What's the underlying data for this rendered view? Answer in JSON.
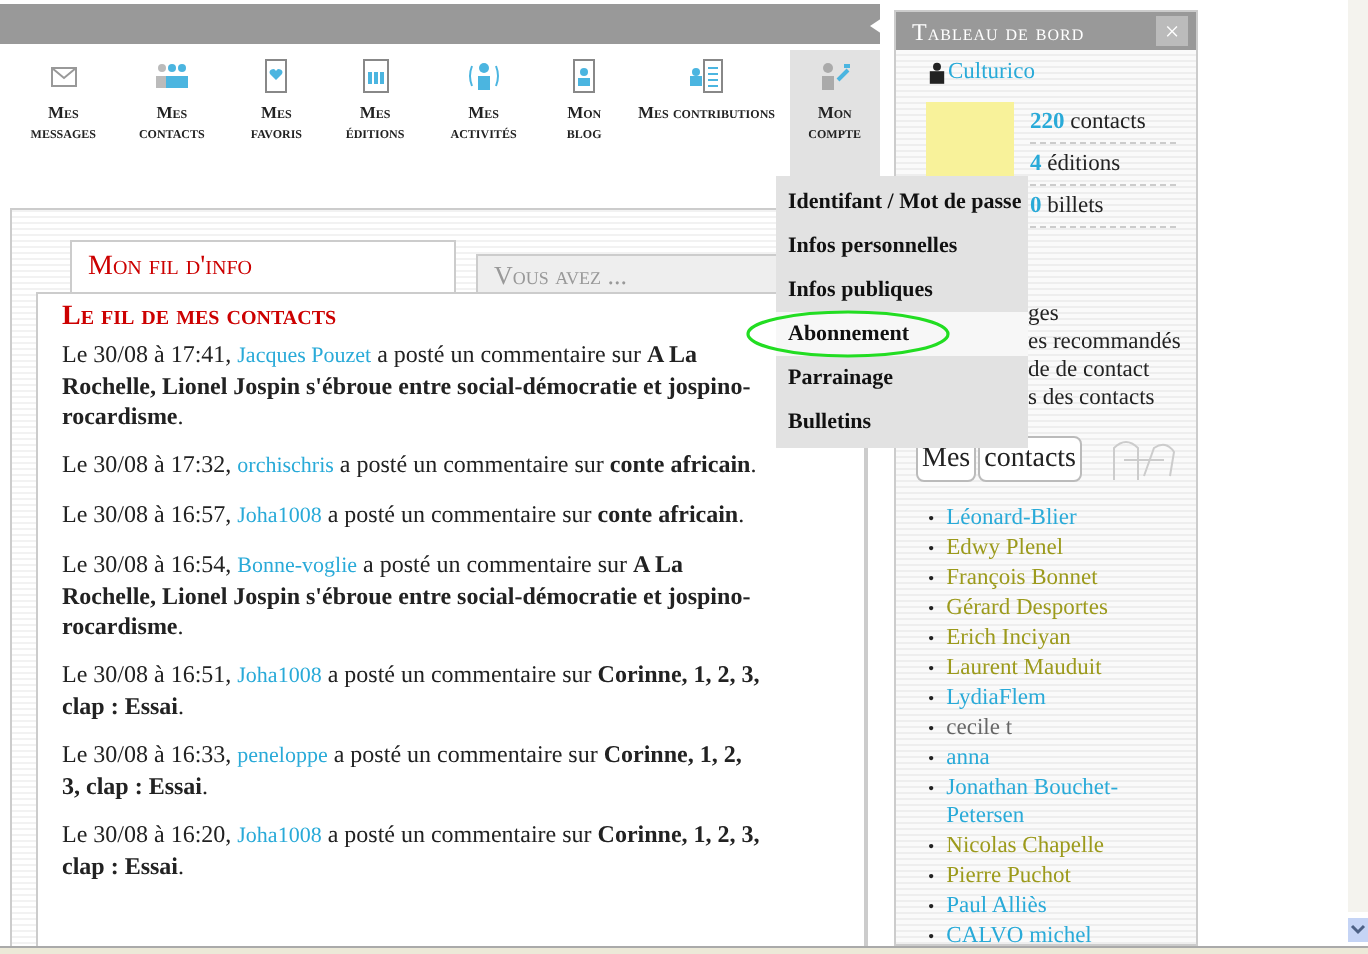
{
  "nav": [
    {
      "label": "Mes messages",
      "selected": false
    },
    {
      "label": "Mes contacts",
      "selected": false
    },
    {
      "label": "Mes favoris",
      "selected": false
    },
    {
      "label": "Mes éditions",
      "selected": false
    },
    {
      "label": "Mes activités",
      "selected": false
    },
    {
      "label": "Mon blog",
      "selected": false
    },
    {
      "label": "Mes contributions",
      "selected": false
    },
    {
      "label": "Mon compte",
      "selected": true
    }
  ],
  "account_menu": [
    {
      "label": "Identifant / Mot de passe",
      "selected": false,
      "circled": false
    },
    {
      "label": "Infos personnelles",
      "selected": false,
      "circled": false
    },
    {
      "label": "Infos publiques",
      "selected": false,
      "circled": false
    },
    {
      "label": "Abonnement",
      "selected": true,
      "circled": true
    },
    {
      "label": "Parrainage",
      "selected": false,
      "circled": false
    },
    {
      "label": "Bulletins",
      "selected": false,
      "circled": false
    }
  ],
  "tabs": [
    {
      "label": "Mon fil d'info",
      "selected": true
    },
    {
      "label": "Vous avez ...",
      "selected": false
    }
  ],
  "feed": {
    "heading": "Le fil de mes contacts",
    "entries": [
      {
        "when": "Le 30/08 à 17:41,",
        "user": "Jacques Pouzet",
        "text": "a posté un commentaire sur **A La Rochelle, Lionel Jospin s'ébroue entre social-démocratie et jospino-rocardisme**."
      },
      {
        "when": "Le 30/08 à 17:32,",
        "user": "orchischris",
        "text": "a posté un commentaire sur **conte africain**."
      },
      {
        "when": "Le 30/08 à 16:57,",
        "user": "Joha1008",
        "text": "a posté un commentaire sur **conte africain**."
      },
      {
        "when": "Le 30/08 à 16:54,",
        "user": "Bonne-voglie",
        "text": "a posté un commentaire sur **A La Rochelle, Lionel Jospin s'ébroue entre social-démocratie et jospino-rocardisme**."
      },
      {
        "when": "Le 30/08 à 16:51,",
        "user": "Joha1008",
        "text": "a posté un commentaire sur **Corinne, 1, 2, 3, clap : Essai**."
      },
      {
        "when": "Le 30/08 à 16:33,",
        "user": "peneloppe",
        "text": "a posté un commentaire sur **Corinne, 1, 2, 3, clap : Essai**."
      },
      {
        "when": "Le 30/08 à 16:20,",
        "user": "Joha1008",
        "text": "a posté un commentaire sur **Corinne, 1, 2, 3, clap : Essai**."
      }
    ]
  },
  "dashboard": {
    "title": "Tableau de bord",
    "close": "×",
    "user": "Culturico",
    "stats": [
      {
        "value": "220",
        "label": "contacts"
      },
      {
        "value": "4",
        "label": "éditions"
      },
      {
        "value": "0",
        "label": "billets"
      }
    ],
    "links": [
      "ges",
      "es recommandés",
      "de de contact",
      "s des contacts"
    ],
    "contacts_title": [
      "Mes",
      "contacts"
    ],
    "contacts": [
      {
        "bullet": "•",
        "name": "Léonard-Blier",
        "color": "#29aad8"
      },
      {
        "bullet": "•",
        "name": "Edwy Plenel",
        "color": "#9c9a1c"
      },
      {
        "bullet": "•",
        "name": "François Bonnet",
        "color": "#9c9a1c"
      },
      {
        "bullet": "•",
        "name": "Gérard Desportes",
        "color": "#9c9a1c"
      },
      {
        "bullet": "•",
        "name": "Erich Inciyan",
        "color": "#9c9a1c"
      },
      {
        "bullet": "•",
        "name": "Laurent Mauduit",
        "color": "#9c9a1c"
      },
      {
        "bullet": "•",
        "name": "LydiaFlem",
        "color": "#29aad8"
      },
      {
        "bullet": "•",
        "name": "cecile t",
        "color": "#666666"
      },
      {
        "bullet": "•",
        "name": "anna",
        "color": "#29aad8"
      },
      {
        "bullet": "•",
        "name": "Jonathan Bouchet-Petersen",
        "color": "#29aad8"
      },
      {
        "bullet": "•",
        "name": "Nicolas Chapelle",
        "color": "#9c9a1c"
      },
      {
        "bullet": "•",
        "name": "Pierre Puchot",
        "color": "#9c9a1c"
      },
      {
        "bullet": "•",
        "name": "Paul Alliès",
        "color": "#29aad8"
      },
      {
        "bullet": "•",
        "name": "CALVO michel",
        "color": "#29aad8"
      }
    ]
  }
}
